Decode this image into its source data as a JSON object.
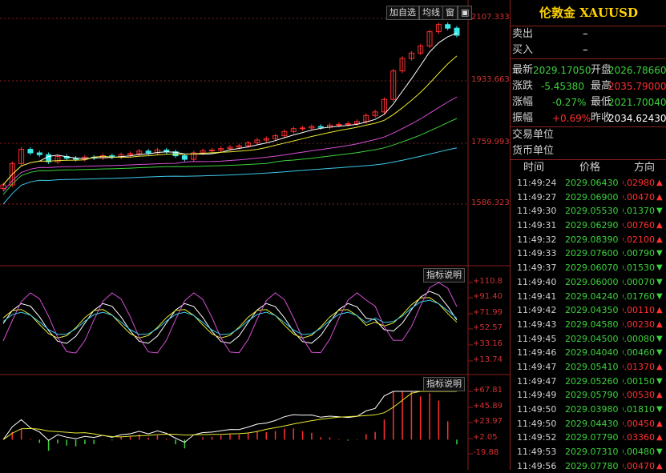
{
  "toolbar": {
    "add_watch": "加自选",
    "ma_line": "均线",
    "window": "窗"
  },
  "main_axis": [
    "2107.333",
    "1933.663",
    "1759.993",
    "1586.323"
  ],
  "indicator_help": "指标说明",
  "kdj_axis": [
    "+110.8",
    "+91.40",
    "+71.99",
    "+52.57",
    "+33.16",
    "+13.74"
  ],
  "macd_axis": [
    "+67.81",
    "+45.89",
    "+23.97",
    "+2.05",
    "-19.88"
  ],
  "panel": {
    "title": "伦敦金 XAUUSD",
    "sell_label": "卖出",
    "sell_value": "–",
    "buy_label": "买入",
    "buy_value": "–",
    "latest_label": "最新",
    "latest_value": "2029.17050",
    "open_label": "开盘",
    "open_value": "2026.78660",
    "change_label": "涨跌",
    "change_value": "-5.45380",
    "high_label": "最高",
    "high_value": "2035.79000",
    "pct_label": "涨幅",
    "pct_value": "-0.27%",
    "low_label": "最低",
    "low_value": "2021.70040",
    "amp_label": "振幅",
    "amp_value": "+0.69%",
    "prev_label": "昨收",
    "prev_value": "2034.62430",
    "unit_label": "交易单位",
    "currency_label": "货币单位",
    "col_time": "时间",
    "col_price": "价格",
    "col_dir": "方向"
  },
  "ticks": [
    {
      "time": "11:49:24",
      "price": "2029.06430",
      "chg": "0.02980",
      "dir": "up"
    },
    {
      "time": "11:49:27",
      "price": "2029.06900",
      "chg": "0.00470",
      "dir": "up"
    },
    {
      "time": "11:49:30",
      "price": "2029.05530",
      "chg": "0.01370",
      "dir": "down"
    },
    {
      "time": "11:49:31",
      "price": "2029.06290",
      "chg": "0.00760",
      "dir": "up"
    },
    {
      "time": "11:49:32",
      "price": "2029.08390",
      "chg": "0.02100",
      "dir": "up"
    },
    {
      "time": "11:49:33",
      "price": "2029.07600",
      "chg": "0.00790",
      "dir": "down"
    },
    {
      "time": "11:49:37",
      "price": "2029.06070",
      "chg": "0.01530",
      "dir": "down"
    },
    {
      "time": "11:49:40",
      "price": "2029.06000",
      "chg": "0.00070",
      "dir": "down"
    },
    {
      "time": "11:49:41",
      "price": "2029.04240",
      "chg": "0.01760",
      "dir": "down"
    },
    {
      "time": "11:49:42",
      "price": "2029.04350",
      "chg": "0.00110",
      "dir": "up"
    },
    {
      "time": "11:49:43",
      "price": "2029.04580",
      "chg": "0.00230",
      "dir": "up"
    },
    {
      "time": "11:49:45",
      "price": "2029.04500",
      "chg": "0.00080",
      "dir": "down"
    },
    {
      "time": "11:49:46",
      "price": "2029.04040",
      "chg": "0.00460",
      "dir": "down"
    },
    {
      "time": "11:49:47",
      "price": "2029.05410",
      "chg": "0.01370",
      "dir": "up"
    },
    {
      "time": "11:49:47",
      "price": "2029.05260",
      "chg": "0.00150",
      "dir": "down"
    },
    {
      "time": "11:49:49",
      "price": "2029.05790",
      "chg": "0.00530",
      "dir": "up"
    },
    {
      "time": "11:49:50",
      "price": "2029.03980",
      "chg": "0.01810",
      "dir": "down"
    },
    {
      "time": "11:49:50",
      "price": "2029.04430",
      "chg": "0.00450",
      "dir": "up"
    },
    {
      "time": "11:49:52",
      "price": "2029.07790",
      "chg": "0.03360",
      "dir": "up"
    },
    {
      "time": "11:49:53",
      "price": "2029.07310",
      "chg": "0.00480",
      "dir": "down"
    },
    {
      "time": "11:49:56",
      "price": "2029.07780",
      "chg": "0.00470",
      "dir": "up"
    }
  ],
  "chart_data": {
    "type": "line",
    "close_series_shape": [
      1640,
      1700,
      1740,
      1730,
      1725,
      1705,
      1720,
      1715,
      1712,
      1718,
      1716,
      1722,
      1718,
      1725,
      1728,
      1735,
      1730,
      1738,
      1733,
      1722,
      1712,
      1730,
      1736,
      1738,
      1742,
      1746,
      1750,
      1758,
      1766,
      1770,
      1778,
      1790,
      1798,
      1800,
      1804,
      1802,
      1808,
      1810,
      1812,
      1818,
      1835,
      1845,
      1880,
      1960,
      1995,
      2010,
      2030,
      2070,
      2090,
      2080,
      2060
    ],
    "main_ylim": [
      1586.323,
      2107.333
    ],
    "kdj_ylim": [
      13.74,
      110.8
    ],
    "macd_ylim": [
      -19.88,
      67.81
    ],
    "colors": {
      "ma5": "#ffffff",
      "ma10": "#e8e832",
      "ma20": "#d64fd6",
      "ma30": "#3cd23c",
      "ma60": "#3cc8e8",
      "up": "#ff3030",
      "down": "#3ce8e8"
    }
  }
}
